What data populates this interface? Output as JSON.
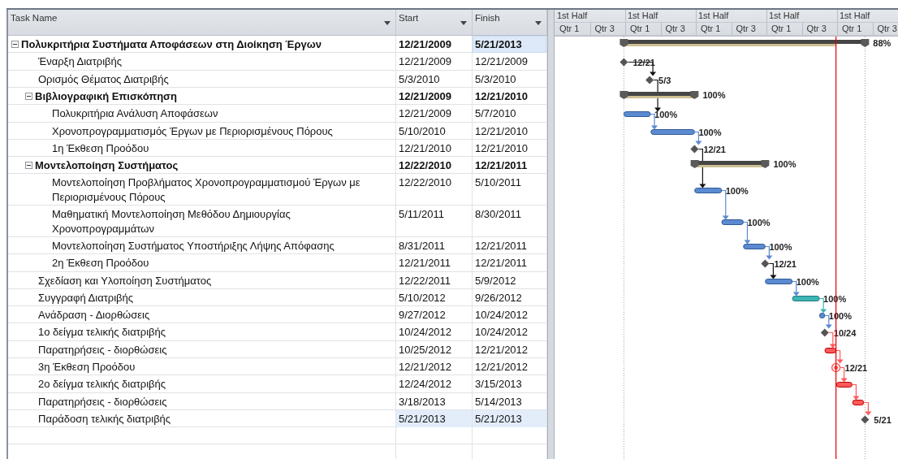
{
  "table": {
    "columns": [
      {
        "label": "Task Name"
      },
      {
        "label": "Start"
      },
      {
        "label": "Finish"
      }
    ],
    "tasks": [
      {
        "name": "Πολυκριτήρια Συστήματα Αποφάσεων στη Διοίκηση Έργων",
        "start": "12/21/2009",
        "finish": "5/21/2013",
        "expanded": true,
        "selected": false,
        "finish_focused": true,
        "bar": {
          "kind": "summary",
          "color": "#454545",
          "level": 0.88,
          "label": "88%"
        },
        "children": [
          {
            "name": "Έναρξη Διατριβής",
            "start": "12/21/2009",
            "finish": "12/21/2009",
            "selected": false,
            "finish_focused": false,
            "bar": {
              "kind": "milestone",
              "color": "#555555",
              "label": "12/21"
            }
          },
          {
            "name": "Ορισμός Θέματος Διατριβής",
            "start": "5/3/2010",
            "finish": "5/3/2010",
            "selected": false,
            "finish_focused": false,
            "bar": {
              "kind": "milestone",
              "color": "#555555",
              "label": "5/3"
            }
          },
          {
            "name": "Βιβλιογραφική Επισκόπηση",
            "start": "12/21/2009",
            "finish": "12/21/2010",
            "expanded": true,
            "selected": false,
            "finish_focused": false,
            "bar": {
              "kind": "summary",
              "color": "#454545",
              "level": 1,
              "label": "100%"
            },
            "children": [
              {
                "name": "Πολυκριτήρια Ανάλυση Αποφάσεων",
                "start": "12/21/2009",
                "finish": "5/7/2010",
                "selected": false,
                "finish_focused": false,
                "bar": {
                  "kind": "task",
                  "color": "#5b8ad0",
                  "label": "100%"
                }
              },
              {
                "name": "Χρονοπρογραμματισμός Έργων με Περιορισμένους Πόρους",
                "start": "5/10/2010",
                "finish": "12/21/2010",
                "selected": false,
                "finish_focused": false,
                "bar": {
                  "kind": "task",
                  "color": "#5b8ad0",
                  "label": "100%"
                }
              },
              {
                "name": "1η Έκθεση Προόδου",
                "start": "12/21/2010",
                "finish": "12/21/2010",
                "selected": false,
                "finish_focused": false,
                "bar": {
                  "kind": "milestone",
                  "color": "#555555",
                  "label": "12/21"
                }
              }
            ]
          },
          {
            "name": "Μοντελοποίηση Συστήματος",
            "start": "12/22/2010",
            "finish": "12/21/2011",
            "expanded": true,
            "selected": false,
            "finish_focused": false,
            "bar": {
              "kind": "summary",
              "color": "#454545",
              "level": 1,
              "label": "100%"
            },
            "children": [
              {
                "name": "Μοντελοποίηση Προβλήματος Χρονοπρογραμματισμού Έργων με Περιορισμένους Πόρους",
                "start": "12/22/2010",
                "finish": "5/10/2011",
                "selected": false,
                "finish_focused": false,
                "bar": {
                  "kind": "task",
                  "color": "#5b8ad0",
                  "label": "100%"
                }
              },
              {
                "name": "Μαθηματική Μοντελοποίηση Μεθόδου Δημιουργίας Χρονοπρογραμμάτων",
                "start": "5/11/2011",
                "finish": "8/30/2011",
                "selected": false,
                "finish_focused": false,
                "bar": {
                  "kind": "task",
                  "color": "#5b8ad0",
                  "label": "100%"
                }
              },
              {
                "name": "Μοντελοποίηση Συστήματος Υποστήριξης Λήψης Απόφασης",
                "start": "8/31/2011",
                "finish": "12/21/2011",
                "selected": false,
                "finish_focused": false,
                "bar": {
                  "kind": "task",
                  "color": "#5b8ad0",
                  "label": "100%"
                }
              },
              {
                "name": "2η Έκθεση Προόδου",
                "start": "12/21/2011",
                "finish": "12/21/2011",
                "selected": false,
                "finish_focused": false,
                "bar": {
                  "kind": "milestone",
                  "color": "#555555",
                  "label": "12/21"
                }
              }
            ]
          },
          {
            "name": "Σχεδίαση και Υλοποίηση Συστήματος",
            "start": "12/22/2011",
            "finish": "5/9/2012",
            "selected": false,
            "finish_focused": false,
            "bar": {
              "kind": "task",
              "color": "#5b8ad0",
              "label": "100%"
            }
          },
          {
            "name": "Συγγραφή Διατριβής",
            "start": "5/10/2012",
            "finish": "9/26/2012",
            "selected": false,
            "finish_focused": false,
            "bar": {
              "kind": "task",
              "color": "#3fb5b5",
              "label": "100%"
            }
          },
          {
            "name": "Ανάδραση - Διορθώσεις",
            "start": "9/27/2012",
            "finish": "10/24/2012",
            "selected": false,
            "finish_focused": false,
            "bar": {
              "kind": "task",
              "color": "#5b8ad0",
              "label": "100%"
            }
          },
          {
            "name": "1ο δείγμα τελικής διατριβής",
            "start": "10/24/2012",
            "finish": "10/24/2012",
            "selected": false,
            "finish_focused": false,
            "bar": {
              "kind": "milestone",
              "color": "#555555",
              "label": "10/24"
            }
          },
          {
            "name": "Παρατηρήσεις - διορθώσεις",
            "start": "10/25/2012",
            "finish": "12/21/2012",
            "selected": false,
            "finish_focused": false,
            "bar": {
              "kind": "task",
              "color": "#ff5a5a"
            }
          },
          {
            "name": "3η Έκθεση Προόδου",
            "start": "12/21/2012",
            "finish": "12/21/2012",
            "selected": false,
            "finish_focused": false,
            "bar": {
              "kind": "milestone",
              "color": "#ff5a5a",
              "label": "12/21"
            }
          },
          {
            "name": "2ο δείγμα τελικής διατριβής",
            "start": "12/24/2012",
            "finish": "3/15/2013",
            "selected": false,
            "finish_focused": false,
            "bar": {
              "kind": "task",
              "color": "#ff5a5a"
            }
          },
          {
            "name": "Παρατηρήσεις - διορθώσεις",
            "start": "3/18/2013",
            "finish": "5/14/2013",
            "selected": false,
            "finish_focused": false,
            "bar": {
              "kind": "task",
              "color": "#ff5a5a"
            }
          },
          {
            "name": "Παράδοση τελικής διατριβής",
            "start": "5/21/2013",
            "finish": "5/21/2013",
            "selected": true,
            "finish_focused": false,
            "bar": {
              "kind": "milestone",
              "color": "#555555",
              "label": "5/21"
            }
          }
        ]
      }
    ]
  },
  "gantt": {
    "timescale": {
      "top_tier": [
        "1st Half",
        "1st Half",
        "1st Half",
        "1st Half",
        "1st Half"
      ],
      "bottom_tier": [
        "Qtr 1",
        "Qtr 3",
        "Qtr 1",
        "Qtr 3",
        "Qtr 1",
        "Qtr 3",
        "Qtr 1",
        "Qtr 3",
        "Qtr 1",
        "Qtr 3"
      ]
    }
  }
}
